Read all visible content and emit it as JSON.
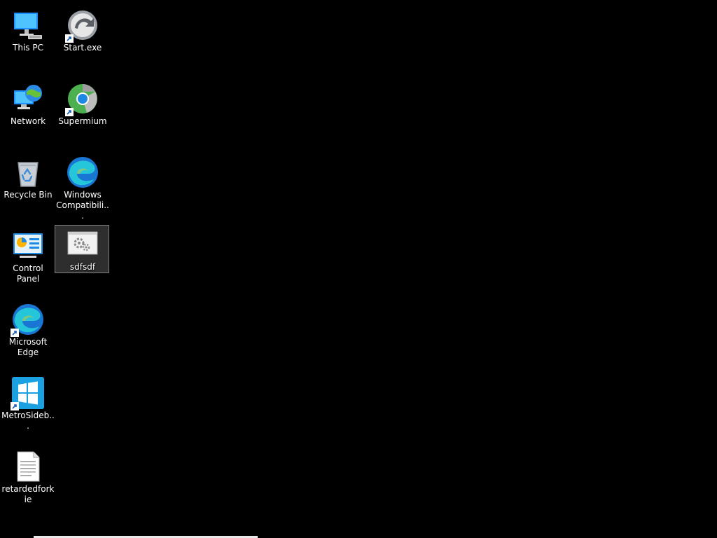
{
  "desktop": {
    "icons": [
      {
        "label": "This PC",
        "icon": "monitor-icon"
      },
      {
        "label": "Start.exe",
        "icon": "start-exe-icon"
      },
      {
        "label": "Network",
        "icon": "network-icon"
      },
      {
        "label": "Supermium",
        "icon": "supermium-icon"
      },
      {
        "label": "Recycle Bin",
        "icon": "recycle-bin-icon"
      },
      {
        "label": "Windows Compatibili...",
        "icon": "edge-icon"
      },
      {
        "label": "Control Panel",
        "icon": "control-panel-icon"
      },
      {
        "label": "sdfsdf",
        "icon": "settings-window-icon"
      },
      {
        "label": "Microsoft Edge",
        "icon": "edge-icon"
      },
      {
        "label": "MetroSideb...",
        "icon": "windows-logo-icon"
      },
      {
        "label": "retardedforkie",
        "icon": "text-file-icon"
      }
    ]
  },
  "colors": {
    "desktop_background": "#000000",
    "selection_fill": "#2e3440",
    "label_text": "#ffffff"
  }
}
